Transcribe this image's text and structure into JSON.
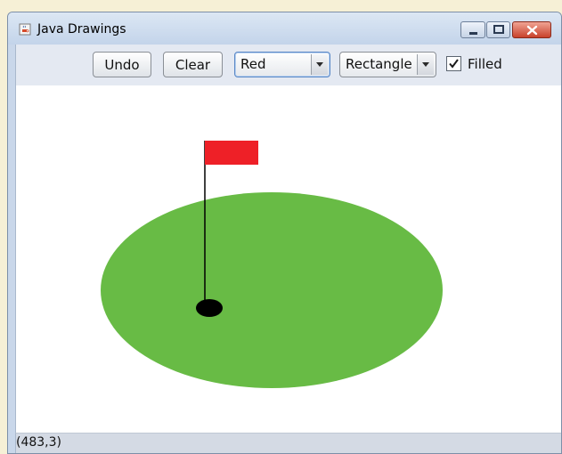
{
  "window": {
    "title": "Java Drawings",
    "app_icon": "java-coffee-cup-icon",
    "controls": [
      "minimize-icon",
      "maximize-icon",
      "close-icon"
    ],
    "accent_close": "#c8412b"
  },
  "toolbar": {
    "undo_label": "Undo",
    "clear_label": "Clear",
    "color_select": {
      "value": "Red"
    },
    "shape_select": {
      "value": "Rectangle"
    },
    "filled": {
      "label": "Filled",
      "checked": true
    }
  },
  "drawing": {
    "shapes": [
      {
        "type": "oval",
        "filled": true,
        "color": "#68bb45"
      },
      {
        "type": "line",
        "color": "#000000"
      },
      {
        "type": "rectangle",
        "filled": true,
        "color": "#ee2027"
      },
      {
        "type": "oval",
        "filled": true,
        "color": "#000000"
      }
    ]
  },
  "status": {
    "coords": "(483,3)"
  }
}
